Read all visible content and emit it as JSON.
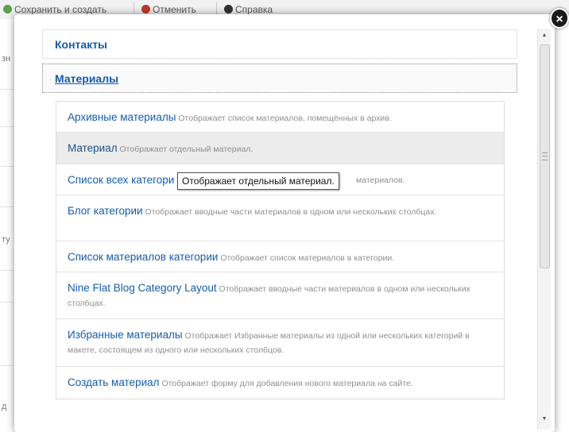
{
  "toolbar": {
    "save_and_create": "Сохранить и создать",
    "cancel": "Отменить",
    "help": "Справка"
  },
  "left_fragments": [
    "зн",
    "ту",
    "д"
  ],
  "accordion": [
    {
      "label": "Контакты",
      "active": false
    },
    {
      "label": "Материалы",
      "active": true
    }
  ],
  "items": [
    {
      "title": "Архивные материалы",
      "desc": "Отображает список материалов, помещённых в архив."
    },
    {
      "title": "Материал",
      "desc": "Отображает отдельный материал."
    },
    {
      "title": "Список всех категори",
      "desc": "материалов."
    },
    {
      "title": "Блог категории",
      "desc": "Отображает вводные части материалов в одном или нескольких столбцах."
    },
    {
      "title": "Список материалов категории",
      "desc": "Отображает список материалов в категории."
    },
    {
      "title": "Nine Flat Blog Category Layout",
      "desc": "Отображает вводные части материалов в одном или нескольких столбцах."
    },
    {
      "title": "Избранные материалы",
      "desc": "Отображает Избранные материалы из одной или нескольких категорий в макете, состоящем из одного или нескольких столбцов."
    },
    {
      "title": "Создать материал",
      "desc": "Отображает форму для добавления нового материала на сайте."
    }
  ],
  "tooltip": "Отображает отдельный материал.",
  "close_label": "×",
  "colors": {
    "link": "#135cae",
    "selected_row": "#ececec"
  }
}
